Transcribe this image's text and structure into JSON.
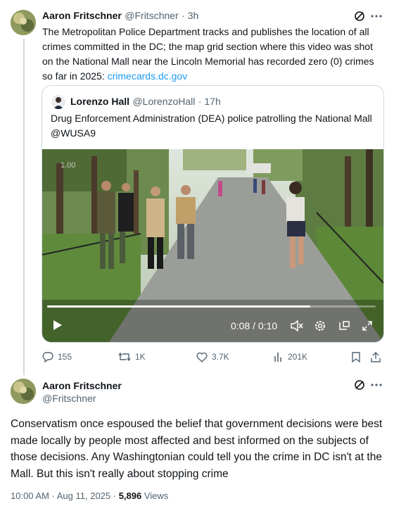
{
  "first_post": {
    "display_name": "Aaron Fritschner",
    "handle": "@Fritschner",
    "time": "· 3h",
    "text": "The Metropolitan Police Department tracks and publishes the location of all crimes committed in the DC; the map grid section where this video was shot on the National Mall near the Lincoln Memorial has recorded zero (0) crimes so far in 2025: ",
    "link": "crimecards.dc.gov",
    "quote": {
      "display_name": "Lorenzo Hall",
      "handle": "@LorenzoHall",
      "time": "· 17h",
      "text": "Drug Enforcement Administration (DEA) police patrolling the National Mall @WUSA9",
      "video": {
        "time_display": "0:08 / 0:10",
        "progress": 0.8,
        "watermark": "1.00"
      }
    },
    "actions": {
      "replies": "155",
      "reposts": "1K",
      "likes": "3.7K",
      "views": "201K"
    }
  },
  "main_post": {
    "display_name": "Aaron Fritschner",
    "handle": "@Fritschner",
    "text": "Conservatism once espoused the belief that government decisions were best made locally by people most affected and best informed on the subjects of those decisions. Any Washingtonian could tell you the crime in DC isn't at the Mall. But this isn't really about stopping crime",
    "timestamp": "10:00 AM · Aug 11, 2025 · ",
    "views_count": "5,896",
    "views_label": " Views"
  },
  "colors": {
    "accent": "#1d9bf0",
    "secondary_text": "#536471",
    "border": "#cfd9de"
  },
  "icons": [
    "grok-icon",
    "more-icon",
    "reply-icon",
    "repost-icon",
    "like-icon",
    "views-icon",
    "bookmark-icon",
    "share-icon",
    "play-icon",
    "volume-icon",
    "settings-icon",
    "pip-icon",
    "fullscreen-icon"
  ]
}
